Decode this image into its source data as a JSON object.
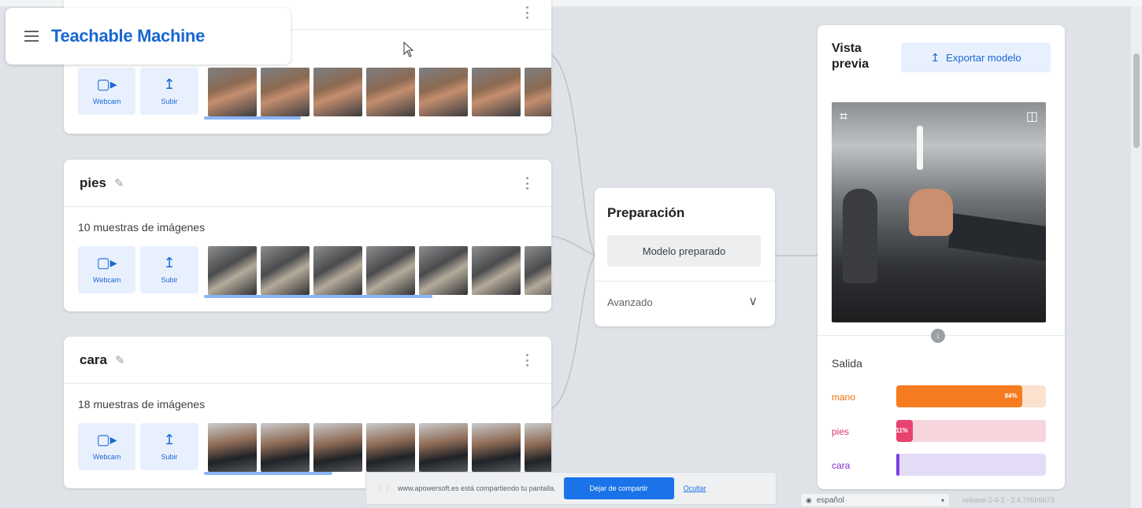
{
  "app": {
    "title": "Teachable Machine"
  },
  "classes": [
    {
      "name": "",
      "samples": "",
      "webcam_label": "Webcam",
      "upload_label": "Subir",
      "progress": 0.28
    },
    {
      "name": "pies",
      "samples": "10 muestras de imágenes",
      "webcam_label": "Webcam",
      "upload_label": "Subir",
      "progress": 0.66
    },
    {
      "name": "cara",
      "samples": "18 muestras de imágenes",
      "webcam_label": "Webcam",
      "upload_label": "Subir",
      "progress": 0.37
    }
  ],
  "training": {
    "title": "Preparación",
    "button_label": "Modelo preparado",
    "advanced_label": "Avanzado"
  },
  "preview": {
    "title": "Vista previa",
    "export_label": "Exportar modelo",
    "output_title": "Salida",
    "outputs": [
      {
        "label": "mano",
        "percent": "84%",
        "value": 0.84,
        "color": "#f57c20",
        "track": "#fbe2cf",
        "label_color": "#e8710a"
      },
      {
        "label": "pies",
        "percent": "11%",
        "value": 0.11,
        "color": "#e8436f",
        "track": "#f7d5dc",
        "label_color": "#d93870"
      },
      {
        "label": "cara",
        "percent": "",
        "value": 0.02,
        "color": "#7b3fe4",
        "track": "#e4dcf7",
        "label_color": "#8430ce"
      }
    ]
  },
  "share_bar": {
    "text": "www.apowersoft.es está compartiendo tu pantalla.",
    "stop_label": "Dejar de compartir",
    "hide_label": "Ocultar"
  },
  "footer": {
    "language": "español",
    "version": "release-2-4-2 - 2.4.7#5b5b73"
  }
}
